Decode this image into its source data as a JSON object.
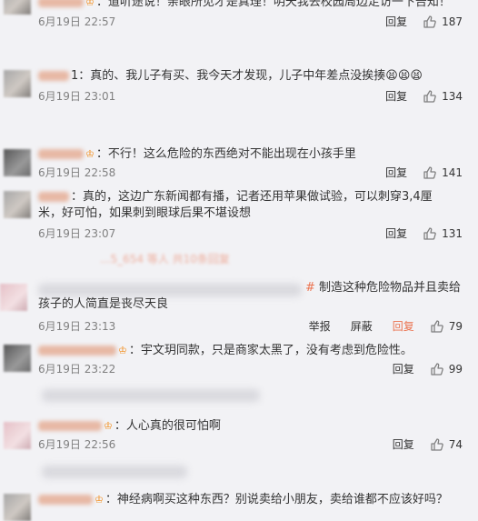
{
  "comments": [
    {
      "text": "：道听途说！亲眼所见才是真理！明天我去校园周边走访一下告知！",
      "time": "6月19日 22:57",
      "reply_label": "回复",
      "likes": "187"
    },
    {
      "text": "1：真的、我儿子有买、我今天才发现，儿子中年差点没挨揍",
      "time": "6月19日 23:01",
      "reply_label": "回复",
      "likes": "134"
    },
    {
      "text": "：不行！这么危险的东西绝对不能出现在小孩手里",
      "time": "6月19日 22:58",
      "reply_label": "回复",
      "likes": "141"
    },
    {
      "text": "：真的，这边广东新闻都有播，记者还用苹果做试验，可以刺穿3,4厘米，好可怕，如果刺到眼球后果不堪设想",
      "time": "6月19日 23:07",
      "reply_label": "回复",
      "likes": "131"
    },
    {
      "more_replies": "...5_654 等人 共10条回复",
      "hashtag": "#",
      "text": " 制造这种危险物品并且卖给孩子的人简直是丧尽天良",
      "time": "6月19日 23:13",
      "report_label": "举报",
      "block_label": "屏蔽",
      "reply_label": "回复",
      "likes": "79"
    },
    {
      "text": "：宇文玥同款，只是商家太黑了，没有考虑到危险性。",
      "time": "6月19日 23:22",
      "reply_label": "回复",
      "likes": "99"
    },
    {
      "text": "：人心真的很可怕啊",
      "time": "6月19日 22:56",
      "reply_label": "回复",
      "likes": "74"
    },
    {
      "text": "：神经病啊买这种东西？别说卖给小朋友，卖给谁都不应该好吗？"
    }
  ],
  "vip_badge": "♔",
  "emoji": "😫😫😫"
}
